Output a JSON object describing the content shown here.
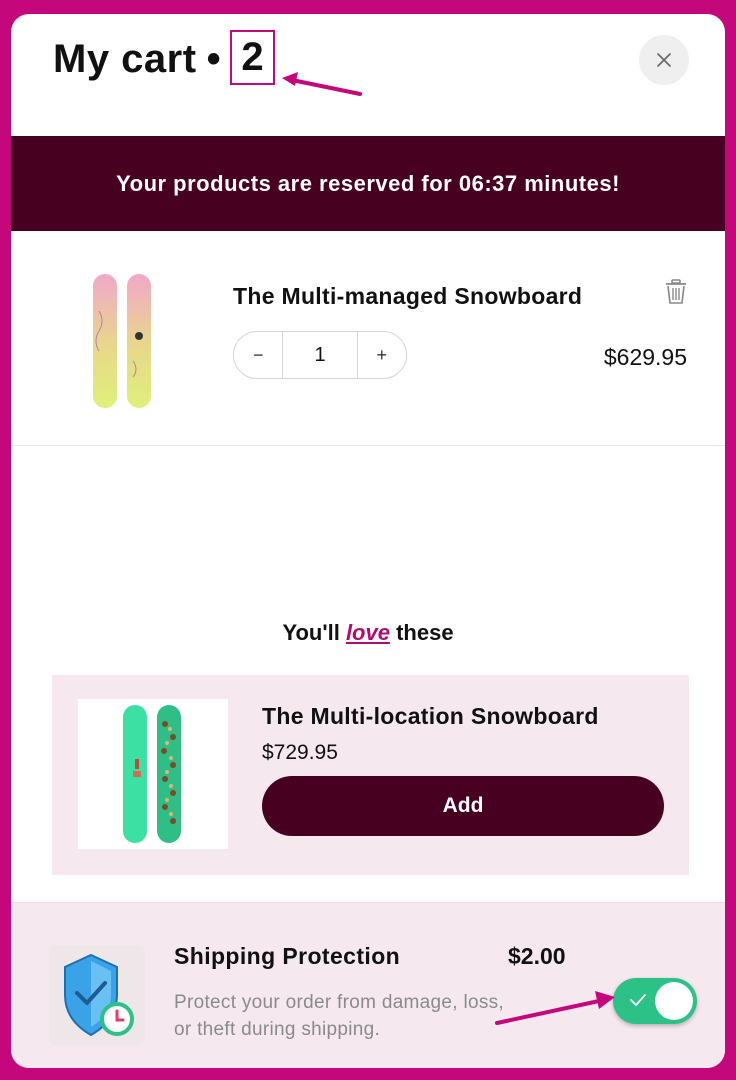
{
  "cart": {
    "title": "My cart",
    "separator": "•",
    "count": "2"
  },
  "reserve": {
    "text": "Your products are reserved for 06:37 minutes!"
  },
  "item": {
    "name": "The Multi-managed Snowboard",
    "quantity": "1",
    "minus": "−",
    "plus": "+",
    "price": "$629.95"
  },
  "recommendations": {
    "prefix": "You'll ",
    "emphasis": "love",
    "suffix": " these",
    "product": {
      "name": "The Multi-location Snowboard",
      "price": "$729.95",
      "add_label": "Add"
    }
  },
  "shipping": {
    "title": "Shipping Protection",
    "price": "$2.00",
    "description": "Protect your order from damage, loss, or theft during shipping.",
    "enabled": true
  },
  "colors": {
    "accent": "#c4077a",
    "brand_dark": "#47001f",
    "toggle_on": "#2bc187",
    "card_bg": "#f6e8ef"
  }
}
